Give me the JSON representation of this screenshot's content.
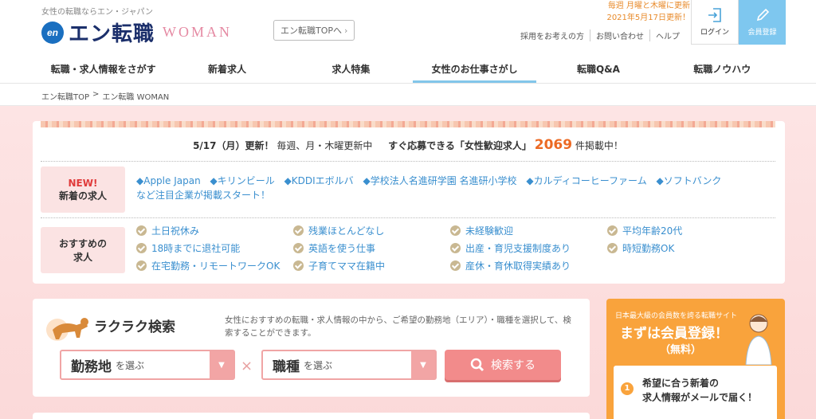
{
  "header": {
    "tagline": "女性の転職ならエン・ジャパン",
    "logo_en": "en",
    "logo_text": "エン転職",
    "logo_woman": "WOMAN",
    "top_link": "エン転職TOPへ",
    "update_line1": "毎週 月曜と木曜に更新",
    "update_line2": "2021年5月17日更新！",
    "sub_links": [
      "採用をお考えの方",
      "お問い合わせ",
      "ヘルプ"
    ],
    "login_label": "ログイン",
    "register_label": "会員登録",
    "login_icon": "login-icon",
    "register_icon": "pencil-icon"
  },
  "nav": {
    "items": [
      "転職・求人情報をさがす",
      "新着求人",
      "求人特集",
      "女性のお仕事さがし",
      "転職Q&A",
      "転職ノウハウ"
    ],
    "active_index": 3,
    "active_color": "#82c6ea"
  },
  "breadcrumb": {
    "items": [
      "エン転職TOP",
      ">",
      "エン転職 WOMAN"
    ]
  },
  "main": {
    "headline_date": "5/17（月）更新！",
    "headline_schedule": "毎週、月・木曜更新中",
    "headline_count_label": "すぐ応募できる「女性歓迎求人」",
    "headline_count": "2069",
    "headline_count_suffix": "件掲載中！",
    "new_label_line1": "NEW!",
    "new_label_line2": "新着の求人",
    "companies": [
      "◆Apple Japan",
      "◆キリンビール",
      "◆KDDIエボルバ",
      "◆学校法人名進研学園 名進研小学校",
      "◆カルディコーヒーファーム",
      "◆ソフトバンク"
    ],
    "companies_suffix": "など注目企業が掲載スタート！",
    "rec_label_line1": "おすすめの",
    "rec_label_line2": "求人",
    "recommendations": [
      "土日祝休み",
      "残業ほとんどなし",
      "未経験歓迎",
      "平均年齢20代",
      "18時までに退社可能",
      "英語を使う仕事",
      "出産・育児支援制度あり",
      "時短勤務OK",
      "在宅勤務・リモートワークOK",
      "子育てママ在籍中",
      "産休・育休取得実績あり"
    ],
    "accent_color": "#ec6a24",
    "link_color": "#3a8fcf"
  },
  "search": {
    "title": "ラクラク検索",
    "description": "女性におすすめの転職・求人情報の中から、ご希望の勤務地（エリア）・職種を選択して、検索することができます。",
    "area_main": "勤務地",
    "area_sub": "を選ぶ",
    "job_main": "職種",
    "job_sub": "を選ぶ",
    "times": "×",
    "button_label": "検索する",
    "button_icon": "search-icon",
    "mascot_icon": "dog-icon"
  },
  "register_box": {
    "small": "日本最大級の会員数を誇る転職サイト",
    "big": "まずは会員登録！",
    "free": "（無料）",
    "benefit_num": "1",
    "benefit_line1": "希望に合う新着の",
    "benefit_line2": "求人情報がメールで届く！",
    "color": "#f9a33c"
  }
}
